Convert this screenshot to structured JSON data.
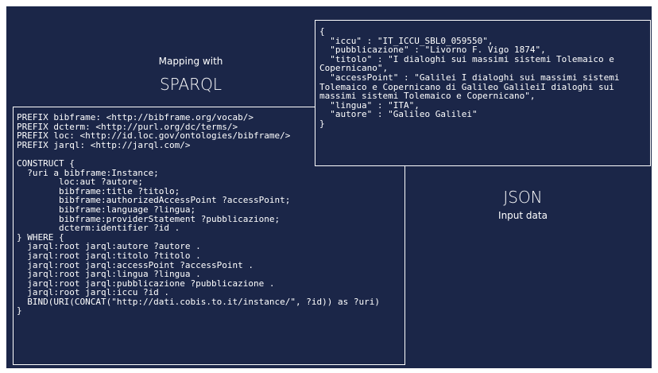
{
  "mapping": {
    "caption": "Mapping with",
    "title": "SPARQL"
  },
  "input": {
    "title": "JSON",
    "caption": "Input data"
  },
  "sparql_lines": [
    "PREFIX bibframe: <http://bibframe.org/vocab/>",
    "PREFIX dcterm: <http://purl.org/dc/terms/>",
    "PREFIX loc: <http://id.loc.gov/ontologies/bibframe/>",
    "PREFIX jarql: <http://jarql.com/>",
    "",
    "CONSTRUCT {",
    "  ?uri a bibframe:Instance;",
    "        loc:aut ?autore;",
    "        bibframe:title ?titolo;",
    "        bibframe:authorizedAccessPoint ?accessPoint;",
    "        bibframe:language ?lingua;",
    "        bibframe:providerStatement ?pubblicazione;",
    "        dcterm:identifier ?id .",
    "} WHERE {",
    "  jarql:root jarql:autore ?autore .",
    "  jarql:root jarql:titolo ?titolo .",
    "  jarql:root jarql:accessPoint ?accessPoint .",
    "  jarql:root jarql:lingua ?lingua .",
    "  jarql:root jarql:pubblicazione ?pubblicazione .",
    "  jarql:root jarql:iccu ?id .",
    "  BIND(URI(CONCAT(\"http://dati.cobis.to.it/instance/\", ?id)) as ?uri)",
    "}"
  ],
  "json_lines": [
    "{",
    "  \"iccu\" : \"IT_ICCU_SBL0_059550\",",
    "  \"pubblicazione\" : \"Livorno F. Vigo 1874\",",
    "  \"titolo\" : \"I dialoghi sui massimi sistemi Tolemaico e",
    "Copernicano\",",
    "  \"accessPoint\" : \"Galilei I dialoghi sui massimi sistemi",
    "Tolemaico e Copernicano di Galileo GalileiI dialoghi sui",
    "massimi sistemi Tolemaico e Copernicano\",",
    "  \"lingua\" : \"ITA\",",
    "  \"autore\" : \"Galileo Galilei\"",
    "}"
  ]
}
